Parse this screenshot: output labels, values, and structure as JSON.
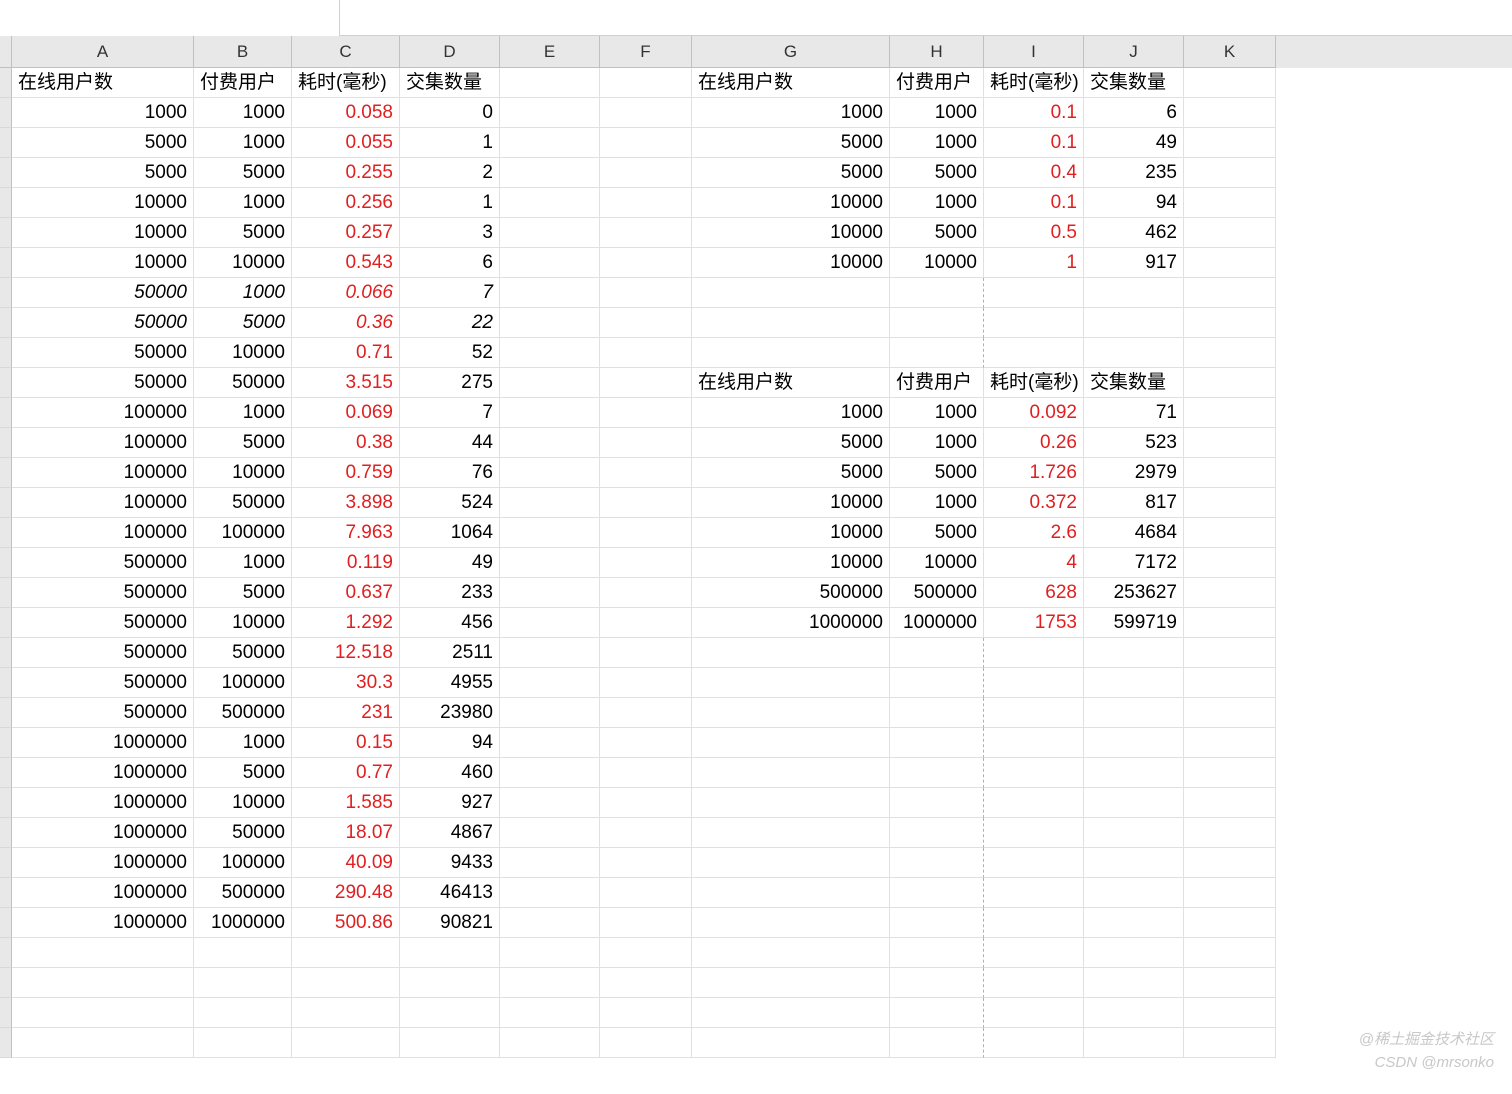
{
  "columns": [
    "A",
    "B",
    "C",
    "D",
    "E",
    "F",
    "G",
    "H",
    "I",
    "J",
    "K"
  ],
  "headers_left": {
    "a": "在线用户数",
    "b": "付费用户",
    "c": "耗时(毫秒)",
    "d": "交集数量"
  },
  "headers_right": {
    "a": "在线用户数",
    "b": "付费用户",
    "c": "耗时(毫秒)",
    "d": "交集数量"
  },
  "left_rows": [
    {
      "a": "1000",
      "b": "1000",
      "c": "0.058",
      "d": "0",
      "it": false
    },
    {
      "a": "5000",
      "b": "1000",
      "c": "0.055",
      "d": "1",
      "it": false
    },
    {
      "a": "5000",
      "b": "5000",
      "c": "0.255",
      "d": "2",
      "it": false
    },
    {
      "a": "10000",
      "b": "1000",
      "c": "0.256",
      "d": "1",
      "it": false
    },
    {
      "a": "10000",
      "b": "5000",
      "c": "0.257",
      "d": "3",
      "it": false
    },
    {
      "a": "10000",
      "b": "10000",
      "c": "0.543",
      "d": "6",
      "it": false
    },
    {
      "a": "50000",
      "b": "1000",
      "c": "0.066",
      "d": "7",
      "it": true
    },
    {
      "a": "50000",
      "b": "5000",
      "c": "0.36",
      "d": "22",
      "it": true
    },
    {
      "a": "50000",
      "b": "10000",
      "c": "0.71",
      "d": "52",
      "it": false
    },
    {
      "a": "50000",
      "b": "50000",
      "c": "3.515",
      "d": "275",
      "it": false
    },
    {
      "a": "100000",
      "b": "1000",
      "c": "0.069",
      "d": "7",
      "it": false
    },
    {
      "a": "100000",
      "b": "5000",
      "c": "0.38",
      "d": "44",
      "it": false
    },
    {
      "a": "100000",
      "b": "10000",
      "c": "0.759",
      "d": "76",
      "it": false
    },
    {
      "a": "100000",
      "b": "50000",
      "c": "3.898",
      "d": "524",
      "it": false
    },
    {
      "a": "100000",
      "b": "100000",
      "c": "7.963",
      "d": "1064",
      "it": false
    },
    {
      "a": "500000",
      "b": "1000",
      "c": "0.119",
      "d": "49",
      "it": false
    },
    {
      "a": "500000",
      "b": "5000",
      "c": "0.637",
      "d": "233",
      "it": false
    },
    {
      "a": "500000",
      "b": "10000",
      "c": "1.292",
      "d": "456",
      "it": false
    },
    {
      "a": "500000",
      "b": "50000",
      "c": "12.518",
      "d": "2511",
      "it": false
    },
    {
      "a": "500000",
      "b": "100000",
      "c": "30.3",
      "d": "4955",
      "it": false
    },
    {
      "a": "500000",
      "b": "500000",
      "c": "231",
      "d": "23980",
      "it": false
    },
    {
      "a": "1000000",
      "b": "1000",
      "c": "0.15",
      "d": "94",
      "it": false
    },
    {
      "a": "1000000",
      "b": "5000",
      "c": "0.77",
      "d": "460",
      "it": false
    },
    {
      "a": "1000000",
      "b": "10000",
      "c": "1.585",
      "d": "927",
      "it": false
    },
    {
      "a": "1000000",
      "b": "50000",
      "c": "18.07",
      "d": "4867",
      "it": false
    },
    {
      "a": "1000000",
      "b": "100000",
      "c": "40.09",
      "d": "9433",
      "it": false
    },
    {
      "a": "1000000",
      "b": "500000",
      "c": "290.48",
      "d": "46413",
      "it": false
    },
    {
      "a": "1000000",
      "b": "1000000",
      "c": "500.86",
      "d": "90821",
      "it": false
    }
  ],
  "right_table_1_start": 0,
  "right_table_1": [
    {
      "a": "1000",
      "b": "1000",
      "c": "0.1",
      "d": "6"
    },
    {
      "a": "5000",
      "b": "1000",
      "c": "0.1",
      "d": "49"
    },
    {
      "a": "5000",
      "b": "5000",
      "c": "0.4",
      "d": "235"
    },
    {
      "a": "10000",
      "b": "1000",
      "c": "0.1",
      "d": "94"
    },
    {
      "a": "10000",
      "b": "5000",
      "c": "0.5",
      "d": "462"
    },
    {
      "a": "10000",
      "b": "10000",
      "c": "1",
      "d": "917"
    }
  ],
  "right_table_2_header_row": 10,
  "right_table_2": [
    {
      "a": "1000",
      "b": "1000",
      "c": "0.092",
      "d": "71"
    },
    {
      "a": "5000",
      "b": "1000",
      "c": "0.26",
      "d": "523"
    },
    {
      "a": "5000",
      "b": "5000",
      "c": "1.726",
      "d": "2979"
    },
    {
      "a": "10000",
      "b": "1000",
      "c": "0.372",
      "d": "817"
    },
    {
      "a": "10000",
      "b": "5000",
      "c": "2.6",
      "d": "4684"
    },
    {
      "a": "10000",
      "b": "10000",
      "c": "4",
      "d": "7172"
    },
    {
      "a": "500000",
      "b": "500000",
      "c": "628",
      "d": "253627"
    },
    {
      "a": "1000000",
      "b": "1000000",
      "c": "1753",
      "d": "599719"
    }
  ],
  "watermark": {
    "line1": "@稀土掘金技术社区",
    "line2": "CSDN @mrsonko"
  },
  "chart_data": {
    "type": "table",
    "tables": [
      {
        "name": "left",
        "columns": [
          "在线用户数",
          "付费用户",
          "耗时(毫秒)",
          "交集数量"
        ],
        "rows": [
          [
            1000,
            1000,
            0.058,
            0
          ],
          [
            5000,
            1000,
            0.055,
            1
          ],
          [
            5000,
            5000,
            0.255,
            2
          ],
          [
            10000,
            1000,
            0.256,
            1
          ],
          [
            10000,
            5000,
            0.257,
            3
          ],
          [
            10000,
            10000,
            0.543,
            6
          ],
          [
            50000,
            1000,
            0.066,
            7
          ],
          [
            50000,
            5000,
            0.36,
            22
          ],
          [
            50000,
            10000,
            0.71,
            52
          ],
          [
            50000,
            50000,
            3.515,
            275
          ],
          [
            100000,
            1000,
            0.069,
            7
          ],
          [
            100000,
            5000,
            0.38,
            44
          ],
          [
            100000,
            10000,
            0.759,
            76
          ],
          [
            100000,
            50000,
            3.898,
            524
          ],
          [
            100000,
            100000,
            7.963,
            1064
          ],
          [
            500000,
            1000,
            0.119,
            49
          ],
          [
            500000,
            5000,
            0.637,
            233
          ],
          [
            500000,
            10000,
            1.292,
            456
          ],
          [
            500000,
            50000,
            12.518,
            2511
          ],
          [
            500000,
            100000,
            30.3,
            4955
          ],
          [
            500000,
            500000,
            231,
            23980
          ],
          [
            1000000,
            1000,
            0.15,
            94
          ],
          [
            1000000,
            5000,
            0.77,
            460
          ],
          [
            1000000,
            10000,
            1.585,
            927
          ],
          [
            1000000,
            50000,
            18.07,
            4867
          ],
          [
            1000000,
            100000,
            40.09,
            9433
          ],
          [
            1000000,
            500000,
            290.48,
            46413
          ],
          [
            1000000,
            1000000,
            500.86,
            90821
          ]
        ]
      },
      {
        "name": "right-top",
        "columns": [
          "在线用户数",
          "付费用户",
          "耗时(毫秒)",
          "交集数量"
        ],
        "rows": [
          [
            1000,
            1000,
            0.1,
            6
          ],
          [
            5000,
            1000,
            0.1,
            49
          ],
          [
            5000,
            5000,
            0.4,
            235
          ],
          [
            10000,
            1000,
            0.1,
            94
          ],
          [
            10000,
            5000,
            0.5,
            462
          ],
          [
            10000,
            10000,
            1,
            917
          ]
        ]
      },
      {
        "name": "right-bottom",
        "columns": [
          "在线用户数",
          "付费用户",
          "耗时(毫秒)",
          "交集数量"
        ],
        "rows": [
          [
            1000,
            1000,
            0.092,
            71
          ],
          [
            5000,
            1000,
            0.26,
            523
          ],
          [
            5000,
            5000,
            1.726,
            2979
          ],
          [
            10000,
            1000,
            0.372,
            817
          ],
          [
            10000,
            5000,
            2.6,
            4684
          ],
          [
            10000,
            10000,
            4,
            7172
          ],
          [
            500000,
            500000,
            628,
            253627
          ],
          [
            1000000,
            1000000,
            1753,
            599719
          ]
        ]
      }
    ]
  }
}
